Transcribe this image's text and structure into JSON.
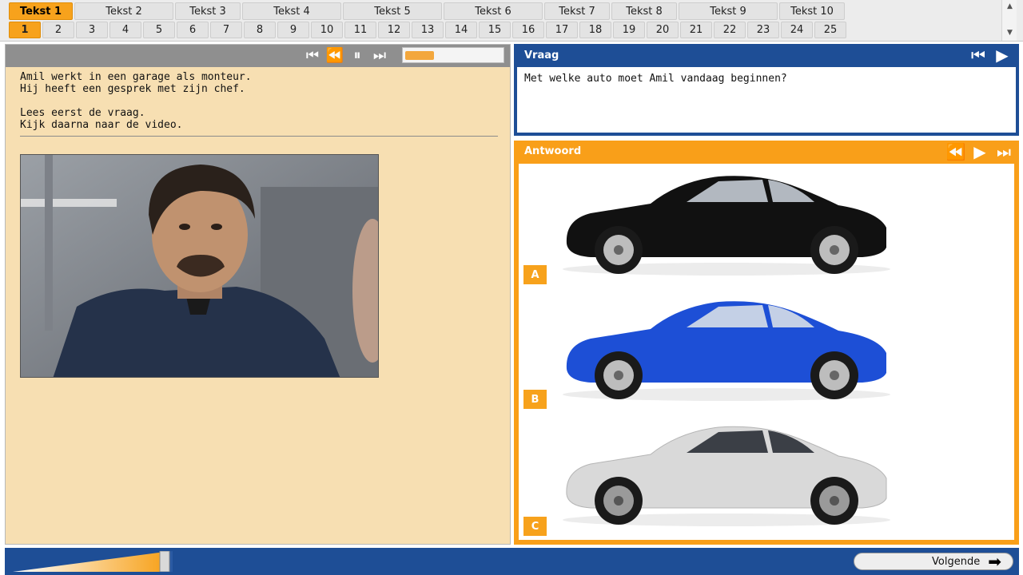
{
  "nav": {
    "tabs": [
      {
        "label": "Tekst 1",
        "active": true
      },
      {
        "label": "Tekst 2"
      },
      {
        "label": "Tekst 3"
      },
      {
        "label": "Tekst 4"
      },
      {
        "label": "Tekst 5"
      },
      {
        "label": "Tekst 6"
      },
      {
        "label": "Tekst 7"
      },
      {
        "label": "Tekst 8"
      },
      {
        "label": "Tekst 9"
      },
      {
        "label": "Tekst 10"
      }
    ],
    "numbers": [
      "1",
      "2",
      "3",
      "4",
      "5",
      "6",
      "7",
      "8",
      "9",
      "10",
      "11",
      "12",
      "13",
      "14",
      "15",
      "16",
      "17",
      "18",
      "19",
      "20",
      "21",
      "22",
      "23",
      "24",
      "25"
    ],
    "active_number": "1"
  },
  "media": {
    "icons": [
      "skip-back-icon",
      "rewind-icon",
      "pause-icon",
      "skip-forward-icon"
    ],
    "progress": 0.3
  },
  "intro": {
    "line1": "Amil werkt in een garage als monteur.",
    "line2": "Hij heeft een gesprek met zijn chef.",
    "line3": "Lees eerst de vraag.",
    "line4": "Kijk daarna naar de video."
  },
  "vraag": {
    "title": "Vraag",
    "question": "Met welke auto moet Amil vandaag beginnen?",
    "icons": [
      "skip-back-icon",
      "play-icon"
    ]
  },
  "antwoord": {
    "title": "Antwoord",
    "icons": [
      "rewind-icon",
      "play-icon",
      "skip-forward-icon"
    ],
    "options": [
      {
        "letter": "A",
        "car_color": "#111111"
      },
      {
        "letter": "B",
        "car_color": "#1d4fd6"
      },
      {
        "letter": "C",
        "car_color": "#d9d9d9"
      }
    ]
  },
  "footer": {
    "next_label": "Volgende",
    "volume": 0.95
  },
  "colors": {
    "accent_orange": "#f7a21c",
    "brand_blue": "#1e4e96",
    "panel_cream": "#f7dfb2"
  }
}
